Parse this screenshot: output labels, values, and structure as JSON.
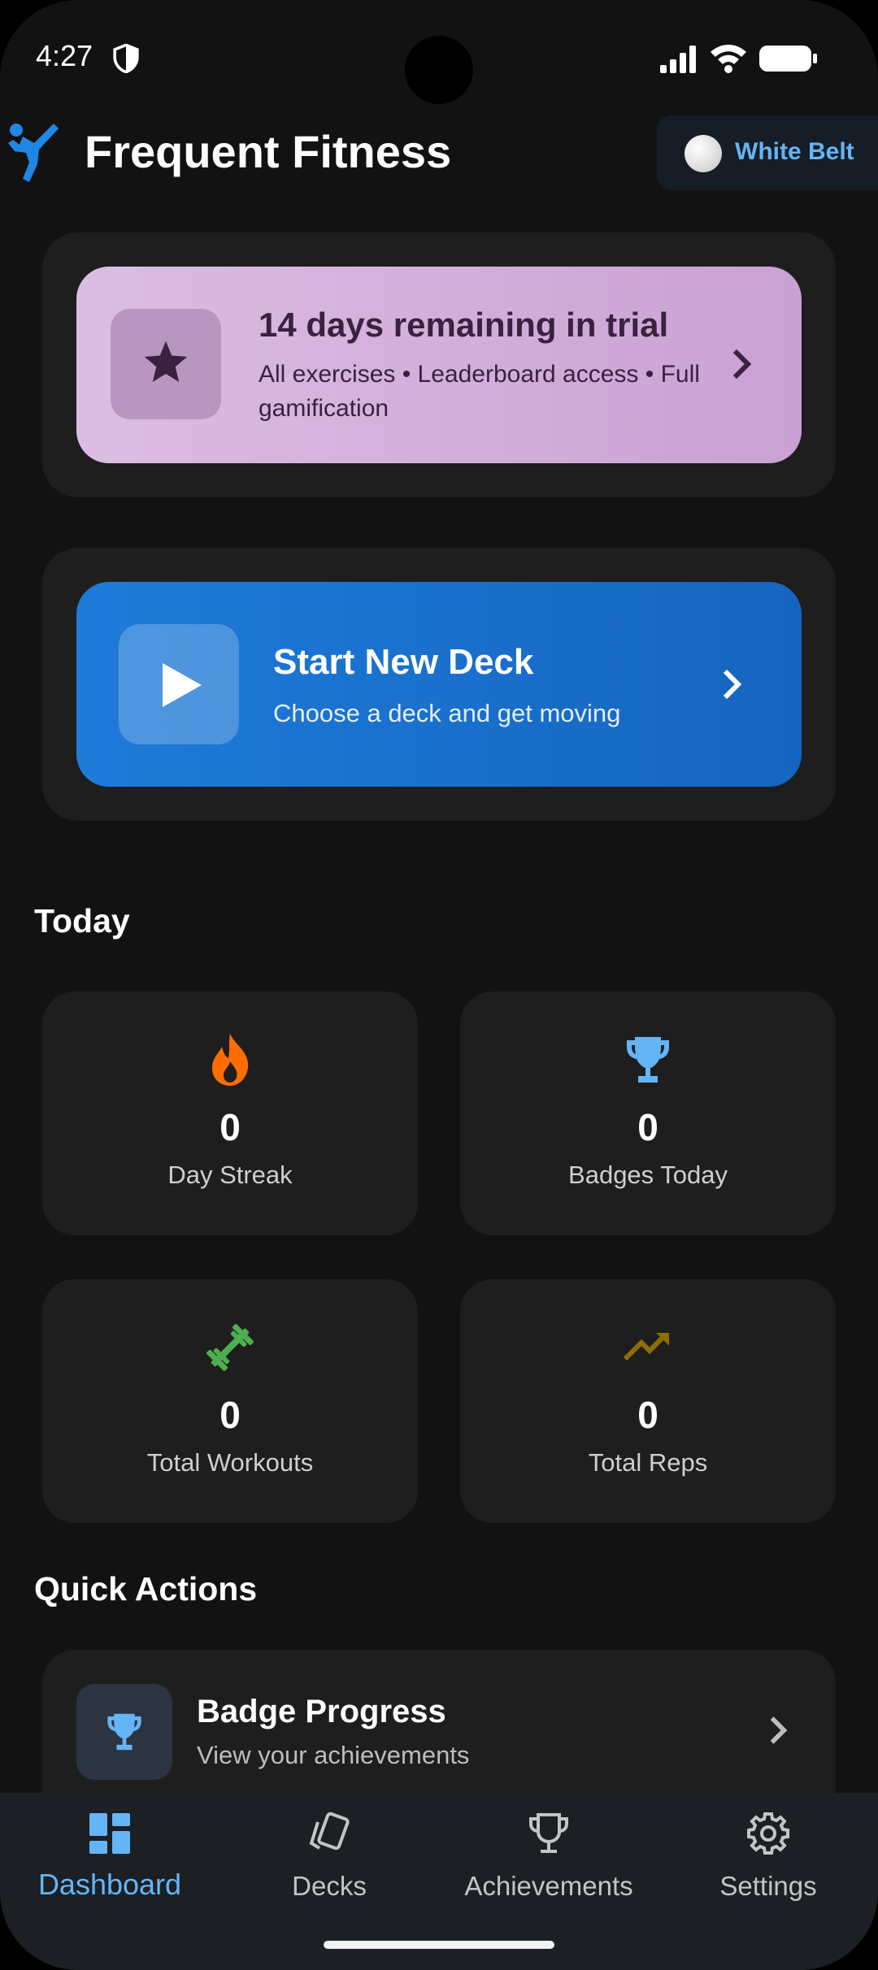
{
  "status_bar": {
    "time": "4:27"
  },
  "header": {
    "title": "Frequent Fitness",
    "belt_label": "White Belt"
  },
  "trial": {
    "title": "14 days remaining in trial",
    "subtitle": "All exercises • Leaderboard access • Full gamification"
  },
  "deck": {
    "title": "Start New Deck",
    "subtitle": "Choose a deck and get moving"
  },
  "today": {
    "title": "Today",
    "stats": [
      {
        "value": "0",
        "label": "Day Streak",
        "icon": "flame-icon",
        "color": "#ff6d00"
      },
      {
        "value": "0",
        "label": "Badges Today",
        "icon": "trophy-icon",
        "color": "#64b5f6"
      },
      {
        "value": "0",
        "label": "Total Workouts",
        "icon": "dumbbell-icon",
        "color": "#4caf50"
      },
      {
        "value": "0",
        "label": "Total Reps",
        "icon": "trending-up-icon",
        "color": "#8d6e00"
      }
    ]
  },
  "quick_actions": {
    "title": "Quick Actions",
    "items": [
      {
        "title": "Badge Progress",
        "subtitle": "View your achievements",
        "icon": "trophy-icon"
      }
    ]
  },
  "nav": {
    "items": [
      {
        "label": "Dashboard",
        "icon": "dashboard-icon",
        "active": true
      },
      {
        "label": "Decks",
        "icon": "cards-icon",
        "active": false
      },
      {
        "label": "Achievements",
        "icon": "trophy-icon",
        "active": false
      },
      {
        "label": "Settings",
        "icon": "gear-icon",
        "active": false
      }
    ]
  },
  "colors": {
    "accent": "#64b5f6",
    "deck_blue": "#1565c0",
    "trial_pink": "#d4b0dc",
    "card_bg": "#1e1e1e",
    "background": "#121212"
  }
}
